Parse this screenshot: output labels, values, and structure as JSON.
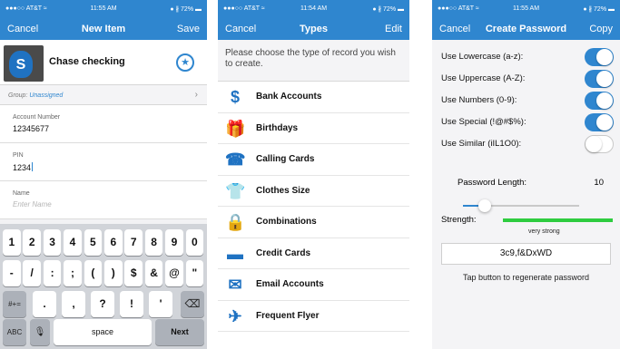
{
  "phone1": {
    "status": {
      "carrier": "●●●○○ AT&T ≈",
      "time": "11:55 AM",
      "battery": "● ∦ 72% ▬"
    },
    "nav": {
      "left": "Cancel",
      "title": "New Item",
      "right": "Save"
    },
    "item_name": "Chase checking",
    "icon_letter": "S",
    "group_label": "Group: ",
    "group_value": "Unassigned",
    "fields": {
      "account_label": "Account Number",
      "account_value": "12345677",
      "pin_label": "PIN",
      "pin_value": "1234",
      "name_label": "Name",
      "name_placeholder": "Enter Name"
    },
    "keyboard": {
      "row1": [
        "1",
        "2",
        "3",
        "4",
        "5",
        "6",
        "7",
        "8",
        "9",
        "0"
      ],
      "row2": [
        "-",
        "/",
        ":",
        ";",
        "(",
        ")",
        "$",
        "&",
        "@",
        "\""
      ],
      "shift": "#+=",
      "row3": [
        ".",
        ",",
        "?",
        "!",
        "'"
      ],
      "delete": "⌫",
      "abc": "ABC",
      "mic": "🎙",
      "space": "space",
      "next": "Next"
    }
  },
  "phone2": {
    "status": {
      "carrier": "●●●○○ AT&T ≈",
      "time": "11:54 AM",
      "battery": "● ∦ 72% ▬"
    },
    "nav": {
      "left": "Cancel",
      "title": "Types",
      "right": "Edit"
    },
    "intro": "Please choose the type of record you wish to create.",
    "types": [
      {
        "label": "Bank Accounts",
        "icon": "money-bag-icon",
        "glyph": "$"
      },
      {
        "label": "Birthdays",
        "icon": "gift-icon",
        "glyph": "🎁"
      },
      {
        "label": "Calling Cards",
        "icon": "phone-icon",
        "glyph": "☎"
      },
      {
        "label": "Clothes Size",
        "icon": "shirt-icon",
        "glyph": "👕"
      },
      {
        "label": "Combinations",
        "icon": "lock-icon",
        "glyph": "🔒"
      },
      {
        "label": "Credit Cards",
        "icon": "credit-card-icon",
        "glyph": "▬"
      },
      {
        "label": "Email Accounts",
        "icon": "envelope-icon",
        "glyph": "✉"
      },
      {
        "label": "Frequent Flyer",
        "icon": "airplane-icon",
        "glyph": "✈"
      }
    ]
  },
  "phone3": {
    "status": {
      "carrier": "●●●○○ AT&T ≈",
      "time": "11:55 AM",
      "battery": "● ∦ 72% ▬"
    },
    "nav": {
      "left": "Cancel",
      "title": "Create Password",
      "right": "Copy"
    },
    "options": [
      {
        "label": "Use Lowercase (a-z):",
        "on": true
      },
      {
        "label": "Use Uppercase (A-Z):",
        "on": true
      },
      {
        "label": "Use Numbers (0-9):",
        "on": true
      },
      {
        "label": "Use Special (!@#$%):",
        "on": true
      },
      {
        "label": "Use Similar (iIL1O0):",
        "on": false
      }
    ],
    "length_label": "Password Length:",
    "length_value": "10",
    "slider_fraction": 0.19,
    "strength_label": "Strength:",
    "strength_text": "very strong",
    "strength_fraction": 1.0,
    "password": "3c9,f&DxWD",
    "hint": "Tap button to regenerate password",
    "colors": {
      "accent": "#2f86cf",
      "strength": "#2ecc40"
    }
  }
}
